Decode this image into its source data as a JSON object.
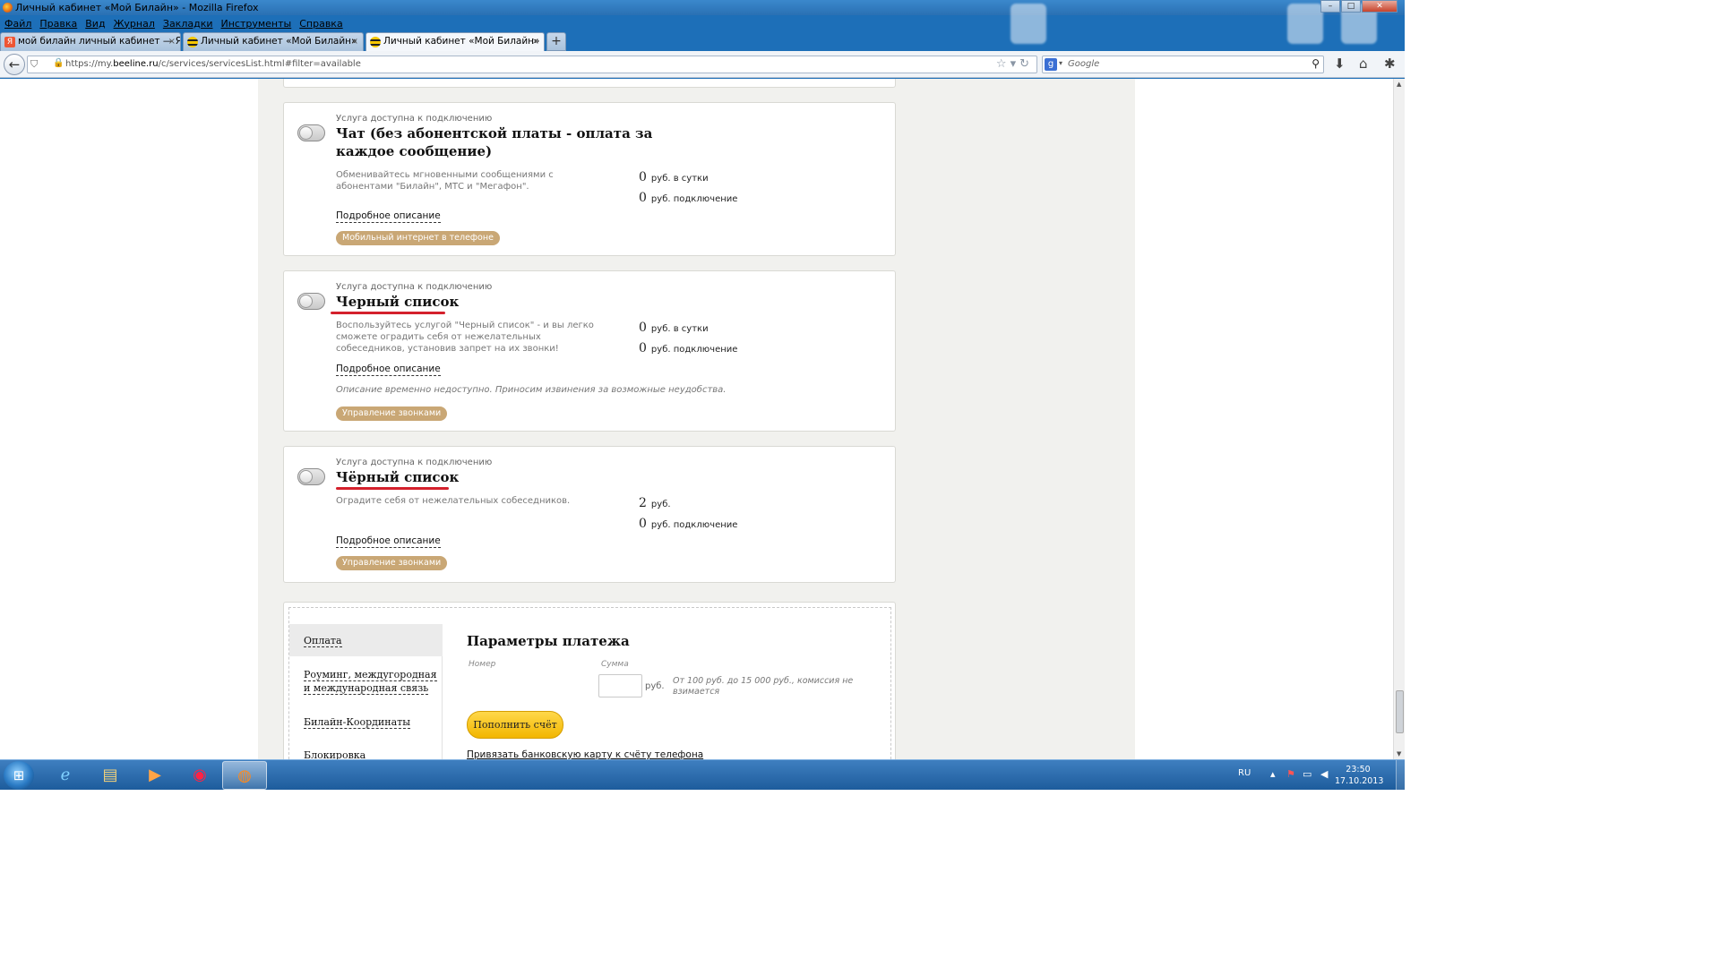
{
  "window": {
    "title": "Личный кабинет «Мой Билайн» - Mozilla Firefox",
    "min": "–",
    "max": "□",
    "close": "✕"
  },
  "menu": [
    "Файл",
    "Правка",
    "Вид",
    "Журнал",
    "Закладки",
    "Инструменты",
    "Справка"
  ],
  "tabs": [
    {
      "label": "мой билайн личный кабинет — Ян...",
      "icon": "yandex-icon",
      "close": "×"
    },
    {
      "label": "Личный кабинет «Мой Билайн»",
      "icon": "beeline-icon",
      "close": "×"
    },
    {
      "label": "Личный кабинет «Мой Билайн»",
      "icon": "beeline-icon",
      "close": "×",
      "active": true
    }
  ],
  "new_tab": "+",
  "nav": {
    "url_prefix": "https://my.",
    "url_domain": "beeline.ru",
    "url_rest": "/c/services/servicesList.html#filter=available",
    "search_placeholder": "Google",
    "search_engine_letter": "g"
  },
  "services": [
    {
      "status": "Услуга доступна к подключению",
      "name": "Чат (без абонентской платы - оплата за каждое сообщение)",
      "description": "Обменивайтесь мгновенными сообщениями с абонентами \"Билайн\", МТС и \"Мегафон\".",
      "prices": [
        {
          "value": "0",
          "unit": "руб.",
          "label": "в сутки"
        },
        {
          "value": "0",
          "unit": "руб.",
          "label": "подключение"
        }
      ],
      "more": "Подробное описание",
      "tag": "Мобильный интернет в телефоне",
      "enabled": false
    },
    {
      "status": "Услуга доступна к подключению",
      "name": "Черный список",
      "description": "Воспользуйтесь услугой \"Черный список\" - и вы легко сможете оградить себя от нежелательных собеседников, установив запрет на их звонки!",
      "prices": [
        {
          "value": "0",
          "unit": "руб.",
          "label": "в сутки"
        },
        {
          "value": "0",
          "unit": "руб.",
          "label": "подключение"
        }
      ],
      "more": "Подробное описание",
      "note": "Описание временно недоступно. Приносим извинения за возможные неудобства.",
      "tag": "Управление звонками",
      "enabled": false
    },
    {
      "status": "Услуга доступна к подключению",
      "name": "Чёрный список",
      "description": "Оградите себя от нежелательных собеседников.",
      "prices": [
        {
          "value": "2",
          "unit": "руб.",
          "label": ""
        },
        {
          "value": "0",
          "unit": "руб.",
          "label": "подключение"
        }
      ],
      "more": "Подробное описание",
      "tag": "Управление звонками",
      "enabled": false
    }
  ],
  "payment": {
    "nav": [
      "Оплата",
      "Роуминг, междугородная и международная связь",
      "Билайн-Координаты",
      "Блокировка"
    ],
    "title": "Параметры платежа",
    "number_label": "Номер",
    "sum_label": "Сумма",
    "currency": "руб.",
    "hint": "От 100 руб. до 15 000 руб., комиссия не взимается",
    "topup_button": "Пополнить счёт",
    "bind_card_link": "Привязать банковскую карту к счёту телефона"
  },
  "taskbar": {
    "lang": "RU",
    "time": "23:50",
    "date": "17.10.2013",
    "apps": [
      "internet-explorer-icon",
      "file-explorer-icon",
      "media-player-icon",
      "chrome-icon",
      "firefox-icon"
    ]
  },
  "colors": {
    "accent": "#f2b600",
    "tag": "#c9a775",
    "underline": "#d4202c",
    "taskbar": "#1d5c9c"
  }
}
